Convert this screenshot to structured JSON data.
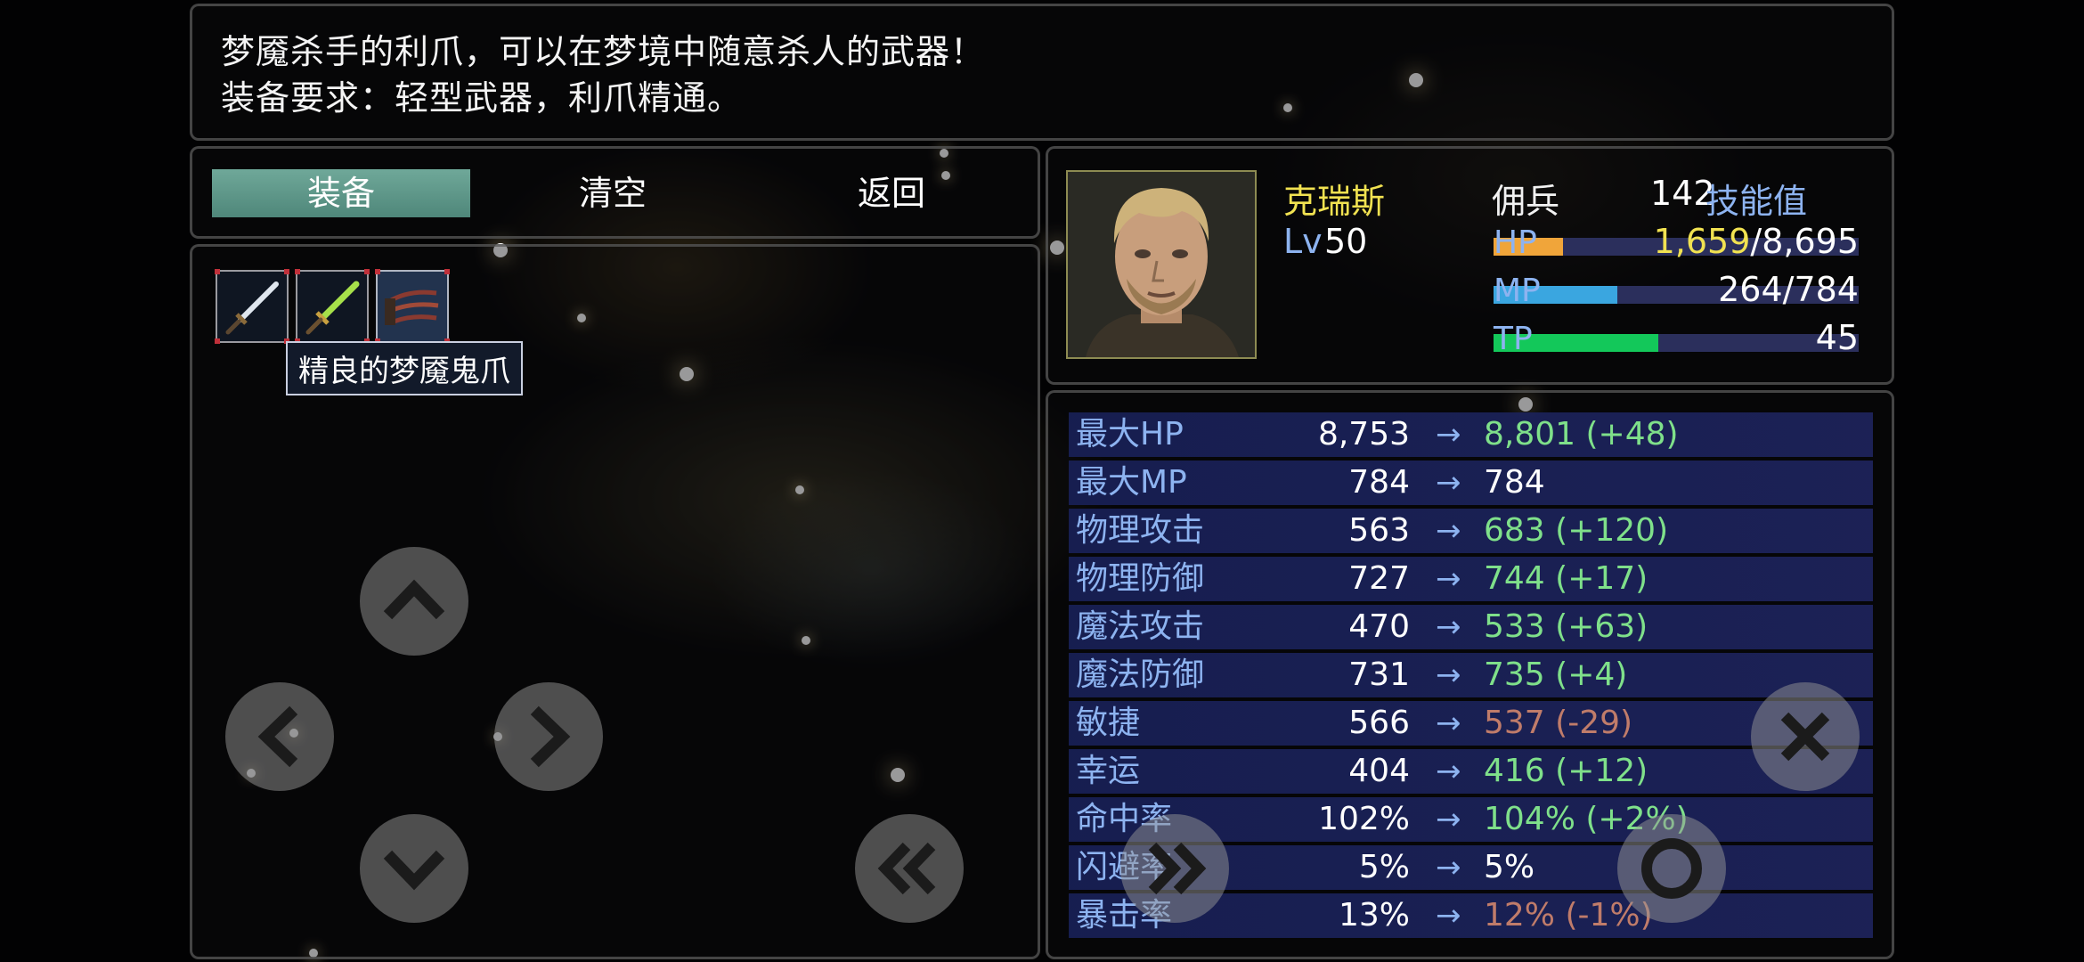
{
  "description": {
    "line1": "梦魇杀手的利爪，可以在梦境中随意杀人的武器！",
    "line2": "装备要求：轻型武器，利爪精通。"
  },
  "commands": {
    "equip": "装备",
    "clear": "清空",
    "back": "返回"
  },
  "items": {
    "tooltip": "精良的梦魇鬼爪",
    "slots": [
      {
        "icon": "steel-sword-icon"
      },
      {
        "icon": "green-sword-icon"
      },
      {
        "icon": "nightmare-claw-icon"
      }
    ]
  },
  "character": {
    "name": "克瑞斯",
    "class": "佣兵",
    "level_label": "Lv",
    "level": "50",
    "skill_points": "142",
    "skill_label": "技能值",
    "hp_label": "HP",
    "hp_current": "1,659",
    "hp_max": "/8,695",
    "hp_fraction": 0.19,
    "mp_label": "MP",
    "mp_value": "264/784",
    "mp_fraction": 0.34,
    "tp_label": "TP",
    "tp_value": "45",
    "tp_fraction": 0.45
  },
  "stats": [
    {
      "name": "最大HP",
      "old": "8,753",
      "new": "8,801 (+48)",
      "trend": "up"
    },
    {
      "name": "最大MP",
      "old": "784",
      "new": "784",
      "trend": "same"
    },
    {
      "name": "物理攻击",
      "old": "563",
      "new": "683 (+120)",
      "trend": "up"
    },
    {
      "name": "物理防御",
      "old": "727",
      "new": "744 (+17)",
      "trend": "up"
    },
    {
      "name": "魔法攻击",
      "old": "470",
      "new": "533 (+63)",
      "trend": "up"
    },
    {
      "name": "魔法防御",
      "old": "731",
      "new": "735 (+4)",
      "trend": "up"
    },
    {
      "name": "敏捷",
      "old": "566",
      "new": "537 (-29)",
      "trend": "down"
    },
    {
      "name": "幸运",
      "old": "404",
      "new": "416 (+12)",
      "trend": "up"
    },
    {
      "name": "命中率",
      "old": "102%",
      "new": "104% (+2%)",
      "trend": "up"
    },
    {
      "name": "闪避率",
      "old": "5%",
      "new": "5%",
      "trend": "same"
    },
    {
      "name": "暴击率",
      "old": "13%",
      "new": "12% (-1%)",
      "trend": "down"
    }
  ],
  "arrow": "→",
  "colors": {
    "name": "#f1e251",
    "label_blue": "#8db3f0",
    "increase": "#7fe08a",
    "decrease": "#c07c6a",
    "hp_bar": "#f0a53a",
    "mp_bar": "#3aa6e0",
    "tp_bar": "#13c85a",
    "stat_row_bg": "#1e2458"
  }
}
